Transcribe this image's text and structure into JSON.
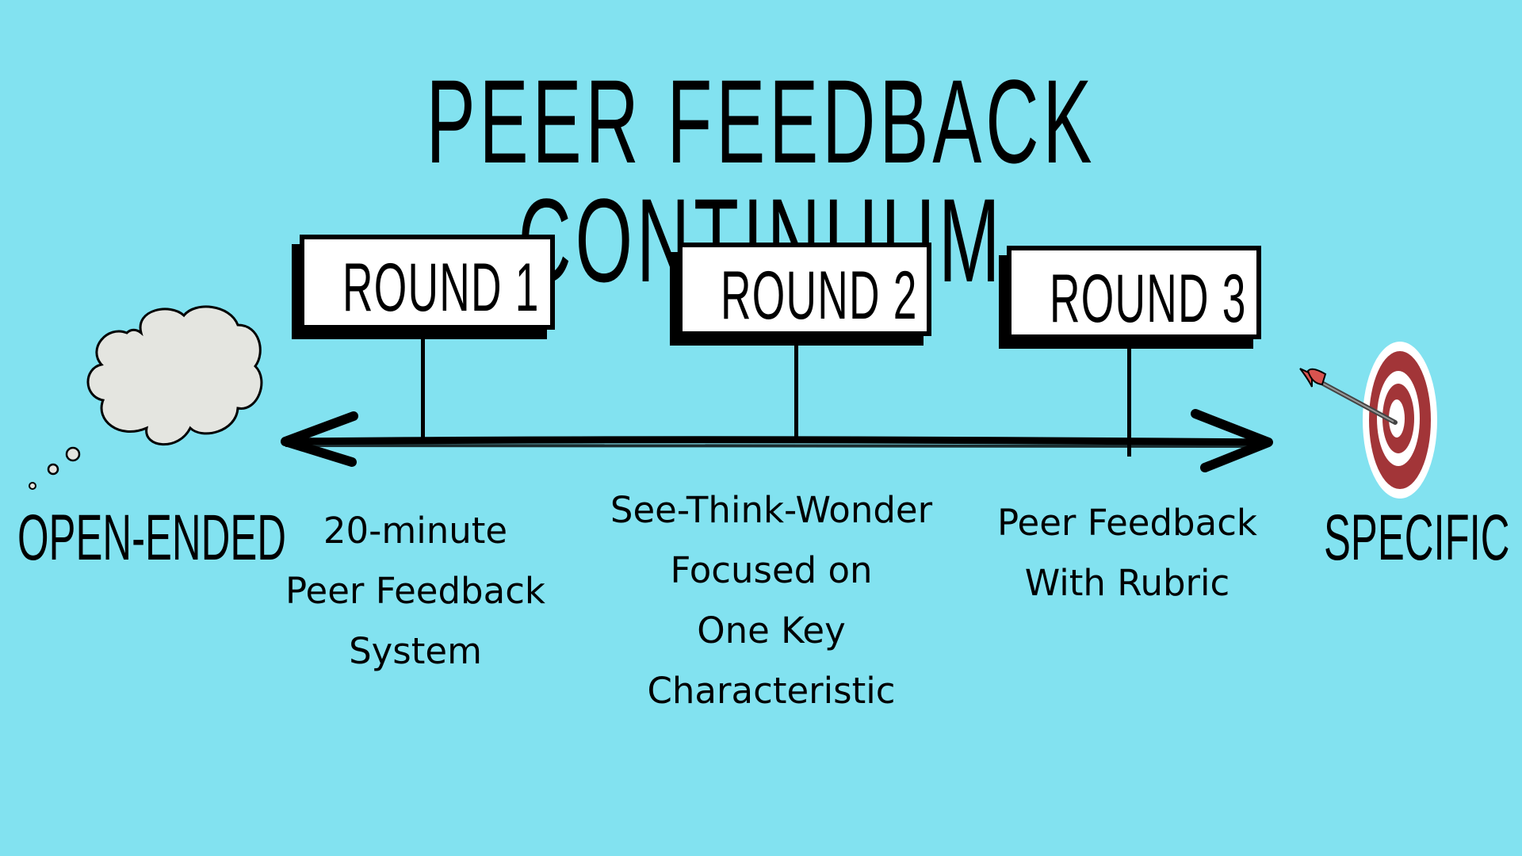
{
  "title": "PEER FEEDBACK CONTINUUM",
  "colors": {
    "background": "#82e2f0",
    "ink": "#000000",
    "sign_fill": "#ffffff",
    "cloud_fill": "#e4e5e0",
    "target_red": "#a23538",
    "dart_red": "#d9534f"
  },
  "ends": {
    "left": {
      "label": "OPEN-ENDED",
      "icon": "thought-cloud-icon"
    },
    "right": {
      "label": "SPECIFIC",
      "icon": "target-dart-icon"
    }
  },
  "rounds": [
    {
      "label": "ROUND 1",
      "caption": [
        "20-minute",
        "Peer Feedback",
        "System"
      ]
    },
    {
      "label": "ROUND 2",
      "caption": [
        "See-Think-Wonder",
        "Focused on",
        "One Key",
        "Characteristic"
      ]
    },
    {
      "label": "ROUND 3",
      "caption": [
        "Peer Feedback",
        "With Rubric"
      ]
    }
  ]
}
